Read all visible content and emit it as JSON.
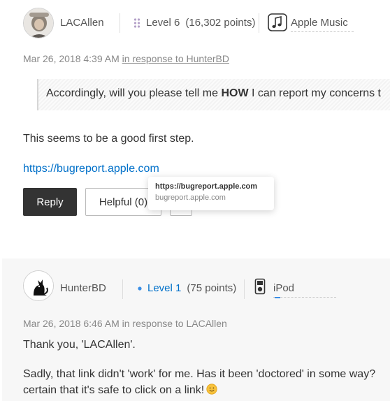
{
  "post1": {
    "author": "LACAllen",
    "level_label": "Level 6",
    "points": "(16,302 points)",
    "community": "Apple Music",
    "date": "Mar 26, 2018 4:39 AM",
    "in_response_label": "in response to HunterBD",
    "quote_before": "Accordingly, will you please tell me ",
    "quote_bold": "HOW",
    "quote_after": " I can report my concerns t",
    "body_text": "This seems to be a good first step.",
    "link_text": "https://bugreport.apple.com",
    "reply_label": "Reply",
    "helpful_label": "Helpful (0)"
  },
  "tooltip": {
    "title": "https://bugreport.apple.com",
    "url": "bugreport.apple.com"
  },
  "post2": {
    "author": "HunterBD",
    "level_label": "Level 1",
    "points": "(75 points)",
    "community": "iPod",
    "date": "Mar 26, 2018 6:46 AM in response to LACAllen",
    "line1": "Thank you, 'LACAllen'.",
    "line2": "Sadly, that link didn't 'work' for me. Has it been 'doctored' in some way?",
    "line3": "certain that it's safe to click on a link!"
  },
  "colors": {
    "link_blue": "#0070c9",
    "level6_dots": "#b4a0c8",
    "level1_dot": "#3a8ee6",
    "reply_bg": "#333333"
  }
}
